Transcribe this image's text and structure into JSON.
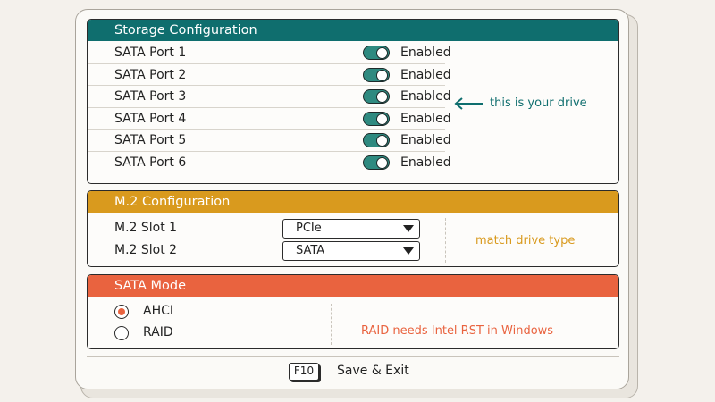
{
  "storage": {
    "title": "Storage Configuration",
    "ports": [
      {
        "label": "SATA Port 1",
        "status": "Enabled",
        "enabled": true
      },
      {
        "label": "SATA Port 2",
        "status": "Enabled",
        "enabled": true
      },
      {
        "label": "SATA Port 3",
        "status": "Enabled",
        "enabled": true
      },
      {
        "label": "SATA Port 4",
        "status": "Enabled",
        "enabled": true
      },
      {
        "label": "SATA Port 5",
        "status": "Enabled",
        "enabled": true
      },
      {
        "label": "SATA Port 6",
        "status": "Enabled",
        "enabled": true
      }
    ],
    "annotation": "this is your drive",
    "annotation_icon": "arrow-left-icon"
  },
  "m2": {
    "title": "M.2 Configuration",
    "slots": [
      {
        "label": "M.2 Slot 1",
        "value": "PCIe"
      },
      {
        "label": "M.2 Slot 2",
        "value": "SATA"
      }
    ],
    "note": "match drive type"
  },
  "sata_mode": {
    "title": "SATA Mode",
    "options": [
      {
        "label": "AHCI",
        "selected": true
      },
      {
        "label": "RAID",
        "selected": false
      }
    ],
    "note": "RAID needs Intel RST in Windows"
  },
  "footer": {
    "key": "F10",
    "action": "Save & Exit"
  },
  "colors": {
    "storage_header": "#0f6e6e",
    "m2_header": "#d99a1e",
    "sata_header": "#e9633f",
    "toggle_on": "#2f8a80"
  }
}
